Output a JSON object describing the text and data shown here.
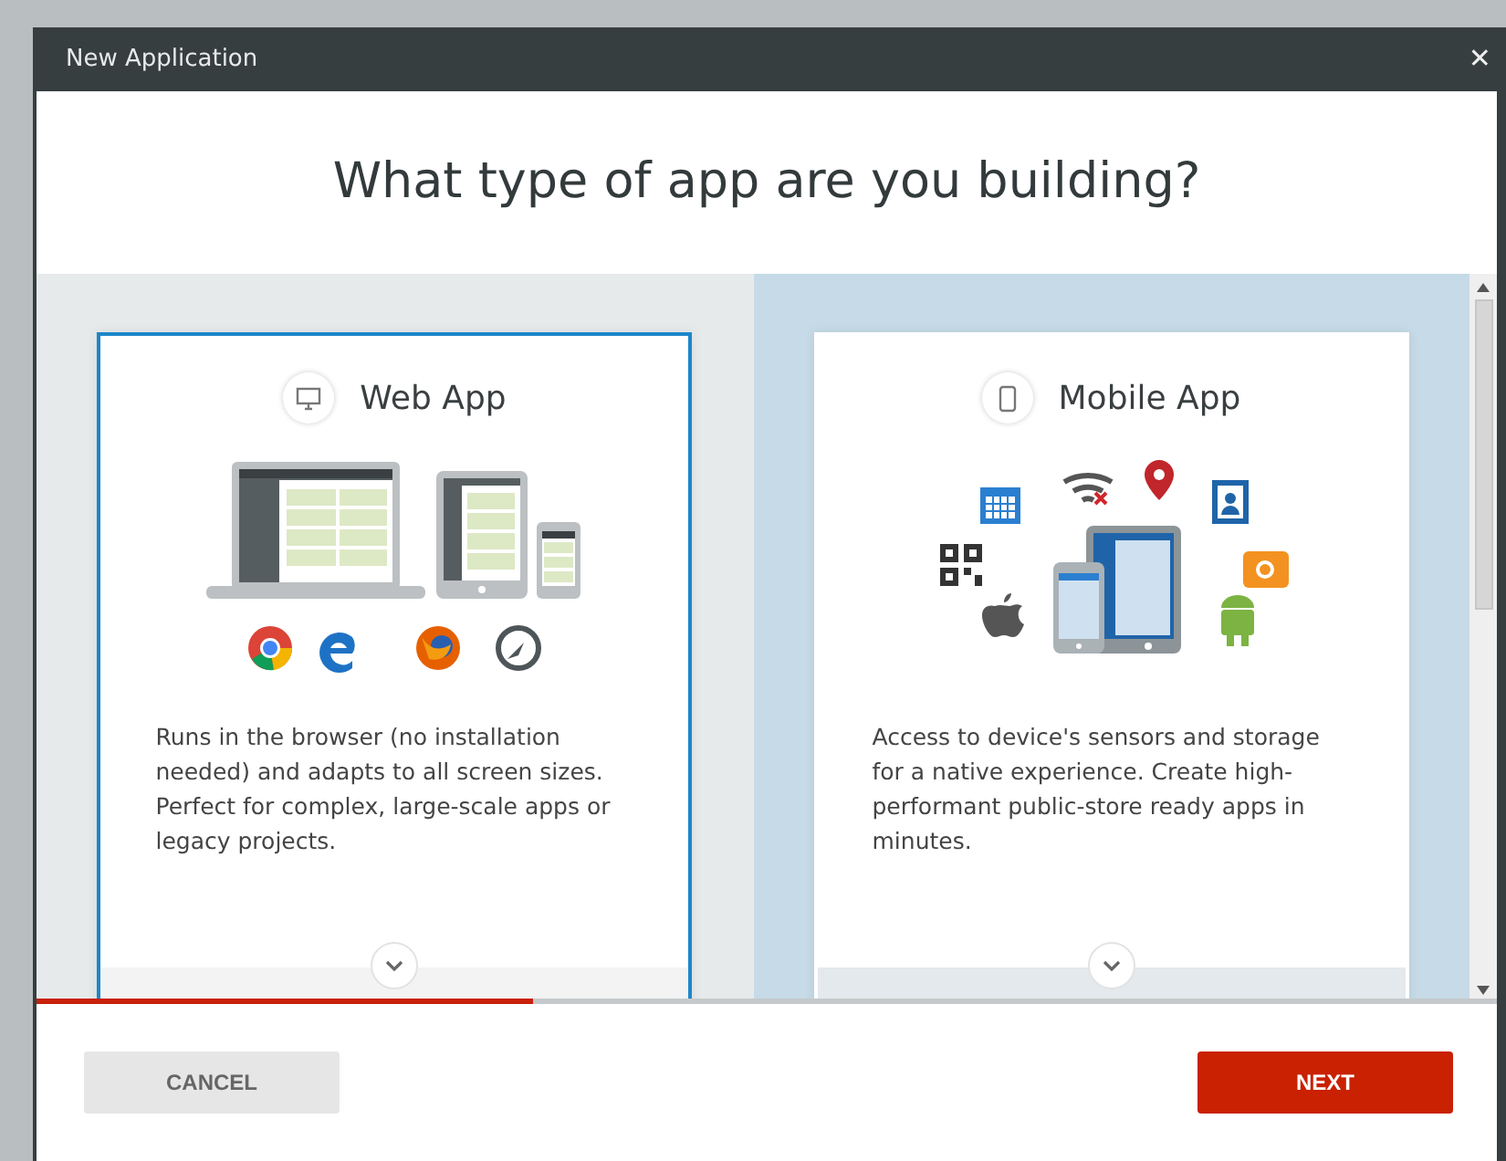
{
  "window": {
    "title": "New Application",
    "close": "✕"
  },
  "heading": "What type of app are you building?",
  "options": [
    {
      "kind": "web",
      "title": "Web App",
      "selected": true,
      "description": "Runs in the browser (no installation needed) and adapts to all screen sizes. Perfect for complex, large-scale apps or legacy projects."
    },
    {
      "kind": "mobile",
      "title": "Mobile App",
      "selected": false,
      "description": "Access to device's sensors and storage for a native experience. Create high-performant public-store ready apps in minutes."
    }
  ],
  "progress": {
    "level": 0.34
  },
  "buttons": [
    {
      "kind": "secondary",
      "label": "CANCEL"
    },
    {
      "kind": "primary",
      "label": "NEXT"
    }
  ]
}
